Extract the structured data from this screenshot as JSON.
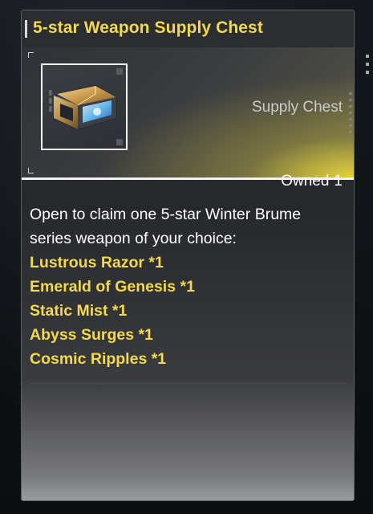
{
  "header": {
    "title": "5-star Weapon Supply Chest"
  },
  "item": {
    "type_label": "Supply Chest",
    "owned_label": "Owned",
    "owned_count": "1",
    "icon": "supply-chest-icon"
  },
  "description": {
    "line1": "Open to claim one 5-star Winter Brume",
    "line2": "series weapon of your choice:"
  },
  "weapons": [
    {
      "label": "Lustrous Razor *1"
    },
    {
      "label": "Emerald of Genesis *1"
    },
    {
      "label": "Static Mist *1"
    },
    {
      "label": "Abyss Surges *1"
    },
    {
      "label": "Cosmic Ripples *1"
    }
  ],
  "colors": {
    "accent_yellow": "#f4d94a",
    "text_white": "#ffffff",
    "panel_bg": "#2a2c30"
  }
}
